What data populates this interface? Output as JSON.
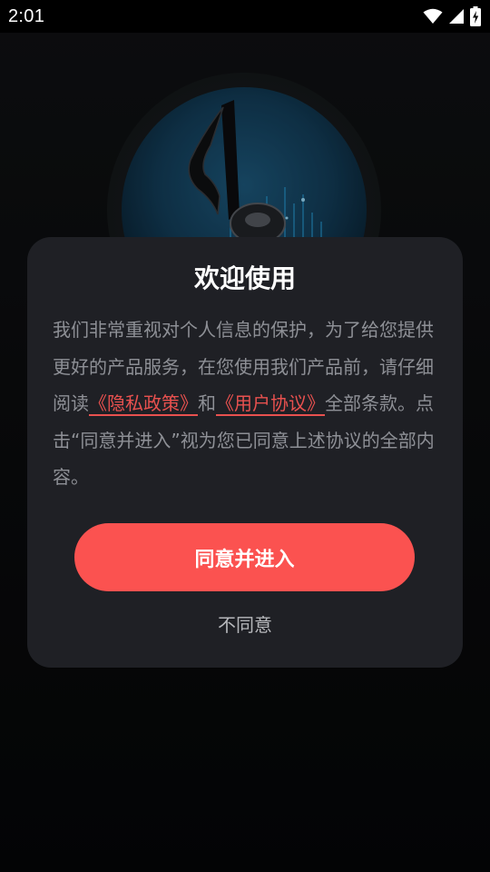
{
  "status_bar": {
    "time": "2:01",
    "icons": [
      "wifi-icon",
      "cellular-signal-icon",
      "battery-charging-icon"
    ]
  },
  "logo": {
    "icon": "music-note-icon"
  },
  "dialog": {
    "title": "欢迎使用",
    "body_prefix": "我们非常重视对个人信息的保护，为了给您提供更好的产品服务，在您使用我们产品前，请仔细阅读",
    "privacy_link": "《隐私政策》",
    "connector": "和",
    "terms_link": "《用户协议》",
    "body_suffix": "全部条款。点击“同意并进入”视为您已同意上述协议的全部内容。",
    "agree_label": "同意并进入",
    "disagree_label": "不同意"
  },
  "colors": {
    "accent": "#fb5250",
    "link": "#e8514f",
    "dialog_bg": "#1f2025",
    "body_text": "#8e9096",
    "page_bg": "#0b0c0e"
  }
}
